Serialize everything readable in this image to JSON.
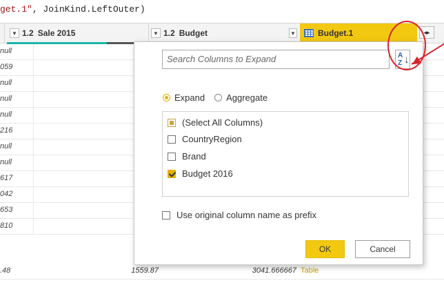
{
  "formula_bar": {
    "text_prefix": "get.1\"",
    "text_suffix": ", JoinKind.LeftOuter)"
  },
  "columns": [
    {
      "type": "1.2",
      "title": "Sale 2015"
    },
    {
      "type": "1.2",
      "title": "Budget"
    },
    {
      "type": "table-icon",
      "title": "Budget.1"
    }
  ],
  "first_column_values": [
    "null",
    "059",
    "null",
    "null",
    "null",
    "216",
    "null",
    "null",
    "617",
    "042",
    "653",
    "810",
    ".48"
  ],
  "last_row": {
    "sale_2015": "1559.87",
    "budget": "3041.666667",
    "budget1": "Table"
  },
  "popup": {
    "search_placeholder": "Search Columns to Expand",
    "sort_label_a": "A",
    "sort_label_z": "Z",
    "radio_expand": "Expand",
    "radio_aggregate": "Aggregate",
    "items": [
      {
        "label": "(Select All Columns)",
        "state": "partial"
      },
      {
        "label": "CountryRegion",
        "state": "off"
      },
      {
        "label": "Brand",
        "state": "off"
      },
      {
        "label": "Budget 2016",
        "state": "on"
      }
    ],
    "prefix_label": "Use original column name as prefix",
    "ok_label": "OK",
    "cancel_label": "Cancel"
  },
  "colors": {
    "accent": "#f2c811",
    "annotation": "#d8232a",
    "quality": "#1ab5a6"
  },
  "icons": {
    "expand": "expand-arrows-icon",
    "sort": "sort-az-icon",
    "dropdown": "chevron-down-icon"
  }
}
